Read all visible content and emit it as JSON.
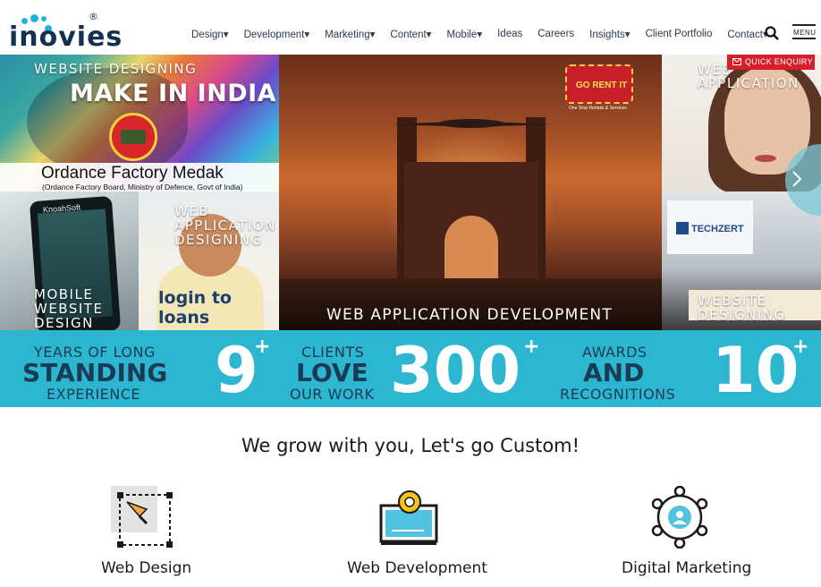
{
  "header": {
    "logo_text": "inovies",
    "logo_reg": "®",
    "nav": [
      {
        "label": "Design▾"
      },
      {
        "label": "Development▾"
      },
      {
        "label": "Marketing▾"
      },
      {
        "label": "Content▾"
      },
      {
        "label": "Mobile▾"
      },
      {
        "label": "Ideas"
      },
      {
        "label": "Careers"
      },
      {
        "label": "Insights▾"
      },
      {
        "label": "Client Portfolio"
      },
      {
        "label": "Contact▾"
      }
    ],
    "menu_label": "MENU",
    "search_icon": "search-icon"
  },
  "collage": {
    "makeindia": {
      "title": "WEBSITE DESIGNING",
      "headline": "MAKE IN INDIA"
    },
    "ordnance": {
      "title": "Ordance Factory Medak",
      "subtitle": "(Ordance Factory Board, Ministry of Defence, Govt of India)"
    },
    "mobile": {
      "title_line1": "MOBILE",
      "title_line2": "WEBSITE",
      "title_line3": "DESIGN",
      "brand": "KnoahSoft"
    },
    "loans": {
      "title_line1": "WEB",
      "title_line2": "APPLICATION",
      "title_line3": "DESIGNING",
      "brand": "login to loans"
    },
    "center": {
      "badge": "GO RENT IT",
      "badge_sub": "One Stop Rentals & Services",
      "caption": "WEB APPLICATION DEVELOPMENT"
    },
    "webapp": {
      "title": "WEB APPLICATION"
    },
    "techzert": {
      "brand": "TECHZERT",
      "title_line1": "WEBSITE",
      "title_line2": "DESIGNING"
    },
    "quick_enquiry": "QUICK ENQUIRY"
  },
  "stats": [
    {
      "top": "YEARS OF LONG",
      "mid": "STANDING",
      "bottom": "EXPERIENCE",
      "number": "9",
      "plus": "+"
    },
    {
      "top": "CLIENTS",
      "mid": "LOVE",
      "bottom": "OUR WORK",
      "number": "300",
      "plus": "+"
    },
    {
      "top": "AWARDS",
      "mid": "AND",
      "bottom": "RECOGNITIONS",
      "number": "10",
      "plus": "+"
    }
  ],
  "tagline": "We grow with you, Let's go Custom!",
  "services": [
    {
      "title": "Web Design",
      "icon": "pen-tool-icon"
    },
    {
      "title": "Web Development",
      "icon": "monitor-gear-icon"
    },
    {
      "title": "Digital Marketing",
      "icon": "network-user-icon"
    }
  ],
  "colors": {
    "accent": "#2db6cf",
    "navy": "#1a3b55",
    "quick": "#d61f2a"
  }
}
